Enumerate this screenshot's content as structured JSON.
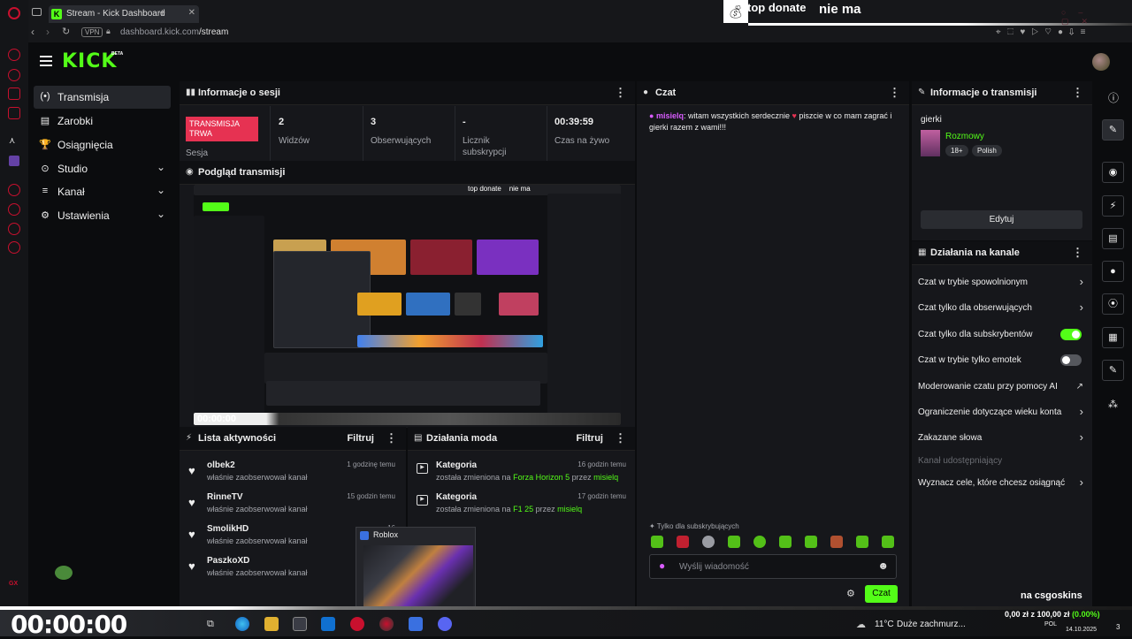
{
  "browser": {
    "tab_title": "Stream - Kick Dashboard",
    "url_host": "dashboard.kick.com",
    "url_path": "/stream",
    "vpn_label": "VPN"
  },
  "overlay": {
    "top_donate": "top donate",
    "no_donors": "nie ma",
    "bottom_label": "na csgoskins",
    "goal": "0,00 zł z 100,00 zł",
    "goal_pct": "(0.00%)",
    "timer": "00:00:00"
  },
  "logo": {
    "text": "KICK",
    "beta": "BETA"
  },
  "nav": [
    {
      "label": "Transmisja",
      "icon": "(•)"
    },
    {
      "label": "Zarobki",
      "icon": "▤"
    },
    {
      "label": "Osiągnięcia",
      "icon": "🏆"
    },
    {
      "label": "Studio",
      "icon": "⊙"
    },
    {
      "label": "Kanał",
      "icon": "≡"
    },
    {
      "label": "Ustawienia",
      "icon": "⚙"
    }
  ],
  "session": {
    "title": "Informacje o sesji",
    "live_badge": "TRANSMISJA TRWA",
    "live_sub": "Sesja",
    "viewers_value": "2",
    "viewers_label": "Widzów",
    "followers_value": "3",
    "followers_label": "Obserwujących",
    "subs_value": "-",
    "subs_label_1": "Licznik",
    "subs_label_2": "subskrypcji",
    "uptime_value": "00:39:59",
    "uptime_label": "Czas na żywo"
  },
  "preview": {
    "title": "Podgląd transmisji",
    "timer": "00:00:00"
  },
  "activity": {
    "title": "Lista aktywności",
    "filter": "Filtruj",
    "items": [
      {
        "name": "olbek2",
        "desc": "właśnie zaobserwował kanał",
        "time": "1 godzinę temu"
      },
      {
        "name": "RinneTV",
        "desc": "właśnie zaobserwował kanał",
        "time": "15 godzin temu"
      },
      {
        "name": "SmolikHD",
        "desc": "właśnie zaobserwował kanał",
        "time": "16"
      },
      {
        "name": "PaszkoXD",
        "desc": "właśnie zaobserwował kanał",
        "time": ""
      }
    ]
  },
  "mod": {
    "title": "Działania moda",
    "filter": "Filtruj",
    "items": [
      {
        "title": "Kategoria",
        "pre": "została zmieniona na",
        "game": "Forza Horizon 5",
        "mid": "przez",
        "user": "misielq",
        "time": "16 godzin temu"
      },
      {
        "title": "Kategoria",
        "pre": "została zmieniona na",
        "game": "F1 25",
        "mid": "przez",
        "user": "misielq",
        "time": "17 godzin temu"
      }
    ]
  },
  "chat": {
    "title": "Czat",
    "message_user": "misielq",
    "message_text_1": ": witam wszystkich serdecznie",
    "message_text_2": " piszcie w co mam zagrać i gierki razem z wami!!!",
    "subs_only_note": "Tylko dla subskrybujących",
    "input_placeholder": "Wyślij wiadomość",
    "send_label": "Czat"
  },
  "stream_info": {
    "title": "Informacje o transmisji",
    "stream_title": "gierki",
    "category": "Rozmowy",
    "tag_age": "18+",
    "tag_lang": "Polish",
    "edit_label": "Edytuj"
  },
  "channel_actions": {
    "title": "Działania na kanale",
    "items": [
      {
        "label": "Czat w trybie spowolnionym",
        "control": "chevron"
      },
      {
        "label": "Czat tylko dla obserwujących",
        "control": "chevron"
      },
      {
        "label": "Czat tylko dla subskrybentów",
        "control": "toggle-on"
      },
      {
        "label": "Czat w trybie tylko emotek",
        "control": "toggle-off"
      },
      {
        "label": "Moderowanie czatu przy pomocy AI",
        "control": "external"
      },
      {
        "label": "Ograniczenie dotyczące wieku konta",
        "control": "chevron"
      },
      {
        "label": "Zakazane słowa",
        "control": "chevron"
      },
      {
        "label": "Kanał udostępniający",
        "control": "none"
      },
      {
        "label": "Wyznacz cele, które chcesz osiągnąć",
        "control": "chevron"
      }
    ]
  },
  "taskbar": {
    "popup_title": "Roblox",
    "weather_temp": "11°C",
    "weather_desc": "Duże zachmurz...",
    "lang": "POL",
    "date": "14.10.2025",
    "notif_count": "3"
  },
  "colors": {
    "kick_green": "#53fc18",
    "live_red": "#e63252",
    "opera_red": "#c8102e"
  }
}
